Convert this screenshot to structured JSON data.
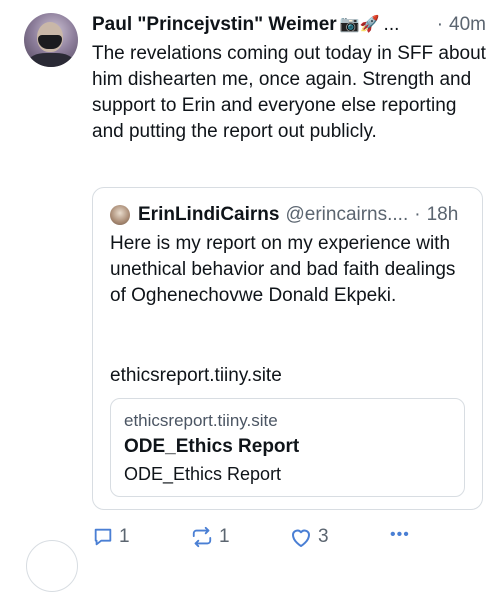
{
  "post": {
    "author_name": "Paul \"Princejvstin\" Weimer",
    "author_emoji": "📷🚀",
    "truncation": "...",
    "time_sep": "·",
    "timestamp": "40m",
    "text": "The revelations coming out today in SFF about him dishearten me, once again. Strength and support to Erin and everyone else reporting and putting the report out publicly."
  },
  "quote": {
    "name": "ErinLindiCairns",
    "handle": "@erincairns....",
    "time_sep": "·",
    "timestamp": "18h",
    "text": "Here is my report on my experience with unethical behavior and bad faith dealings of Oghenechovwe Donald Ekpeki.",
    "link_text": "ethicsreport.tiiny.site",
    "link_card": {
      "domain": "ethicsreport.tiiny.site",
      "title": "ODE_Ethics Report",
      "description": "ODE_Ethics Report"
    }
  },
  "actions": {
    "reply_count": "1",
    "repost_count": "1",
    "like_count": "3",
    "more_label": "•••"
  },
  "icons": {
    "reply": "reply-icon",
    "repost": "repost-icon",
    "like": "heart-icon",
    "more": "more-options-icon"
  },
  "colors": {
    "text": "#0f1419",
    "muted": "#5b6570",
    "border": "#d8dde2",
    "icon": "#4a7fd4"
  }
}
